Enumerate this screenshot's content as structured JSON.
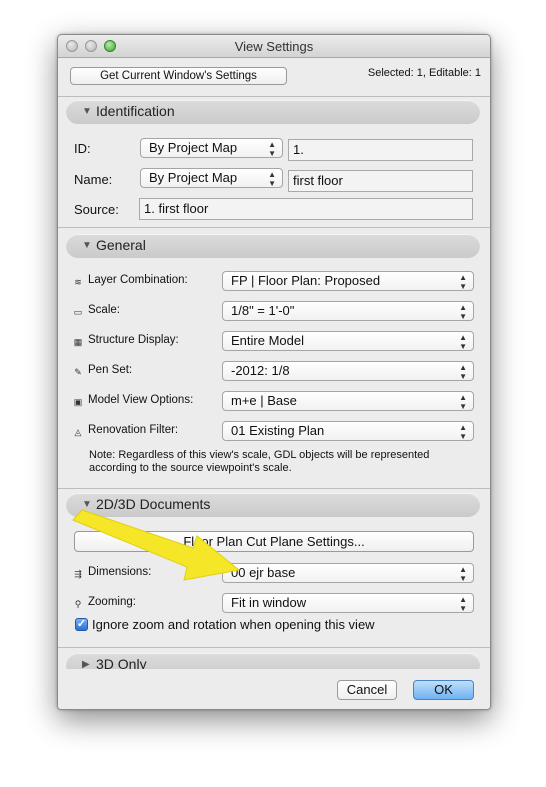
{
  "window": {
    "title": "View Settings"
  },
  "toolbar": {
    "get_settings_label": "Get Current Window's Settings",
    "selection_info": "Selected: 1, Editable: 1"
  },
  "identification": {
    "header": "Identification",
    "id_label": "ID:",
    "id_source": "By Project Map",
    "id_value": "1.",
    "name_label": "Name:",
    "name_source": "By Project Map",
    "name_value": "first floor",
    "source_label": "Source:",
    "source_value": "1. first floor"
  },
  "general": {
    "header": "General",
    "rows": [
      {
        "icon": "layer-combination-icon",
        "label": "Layer Combination:",
        "value": "FP |  Floor Plan: Proposed"
      },
      {
        "icon": "scale-icon",
        "label": "Scale:",
        "value": "1/8\"   =    1'-0\""
      },
      {
        "icon": "structure-display-icon",
        "label": "Structure Display:",
        "value": "Entire Model"
      },
      {
        "icon": "pen-set-icon",
        "label": "Pen Set:",
        "value": "-2012: 1/8"
      },
      {
        "icon": "model-view-options-icon",
        "label": "Model View Options:",
        "value": "m+e | Base"
      },
      {
        "icon": "renovation-filter-icon",
        "label": "Renovation Filter:",
        "value": "01 Existing Plan"
      }
    ],
    "note": "Note: Regardless of this view's scale, GDL objects will be represented according to the source viewpoint's scale."
  },
  "documents_2d3d": {
    "header": "2D/3D Documents",
    "cut_plane_button": "Floor Plan Cut Plane Settings...",
    "dimensions_label": "Dimensions:",
    "dimensions_value": "00 ejr base",
    "zooming_label": "Zooming:",
    "zooming_value": "Fit in window",
    "ignore_zoom_label": "Ignore zoom and rotation when opening this view",
    "ignore_zoom_checked": true
  },
  "only_3d": {
    "header": "3D Only"
  },
  "footer": {
    "cancel_label": "Cancel",
    "ok_label": "OK"
  },
  "colors": {
    "arrow": "#f5e628",
    "ok_button": "#6fb1f0",
    "window_bg": "#ececec"
  }
}
